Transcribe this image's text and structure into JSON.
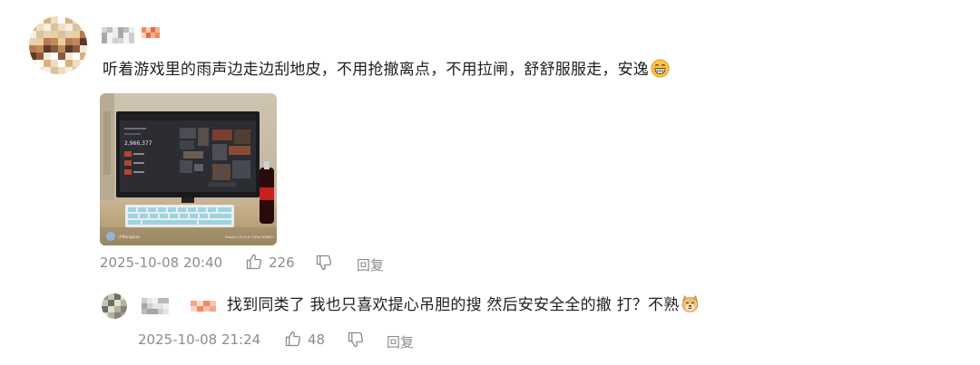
{
  "comment": {
    "text": "听着游戏里的雨声边走边刮地皮，不用抢撤离点，不用拉闸，舒舒服服走，安逸",
    "emoji": "grinning-face-emoji",
    "photo_watermark_left": "小Rongzuo",
    "photo_watermark_right": "Xiaomi 14  f/1.6  1/50s  ISO800",
    "screen_number": "2,966,377",
    "timestamp": "2025-10-08 20:40",
    "likes": "226",
    "reply_label": "回复"
  },
  "reply": {
    "text": "找到同类了 我也只喜欢提心吊胆的搜 然后安安全全的撤 打？不熟",
    "emoji": "doge-emoji",
    "timestamp": "2025-10-08 21:24",
    "likes": "48",
    "reply_label": "回复"
  },
  "colors": {
    "text_primary": "#1f1f1f",
    "meta_gray": "#8c8c8c"
  }
}
